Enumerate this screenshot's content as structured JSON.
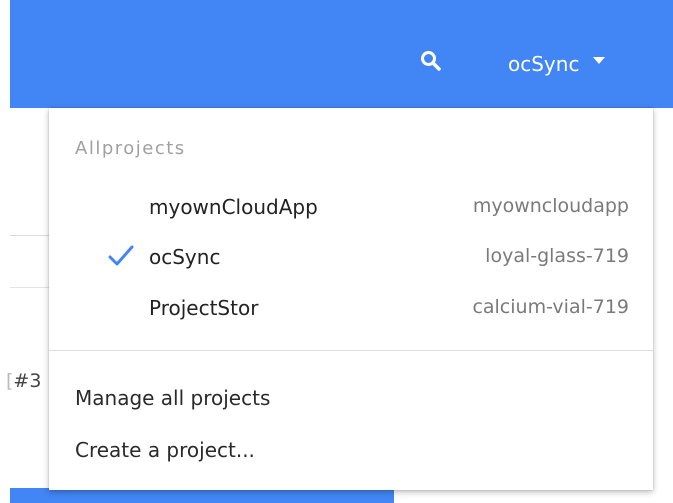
{
  "topbar": {
    "color": "#4285f4",
    "search_icon": "search-icon",
    "current_project": "ocSync",
    "caret_icon": "caret-down-icon"
  },
  "background": {
    "partial_text": "#3"
  },
  "menu": {
    "header": "Allprojects",
    "projects": [
      {
        "name": "myownCloudApp",
        "id": "myowncloudapp",
        "selected": false
      },
      {
        "name": "ocSync",
        "id": "loyal-glass-719",
        "selected": true
      },
      {
        "name": "ProjectStor",
        "id": "calcium-vial-719",
        "selected": false
      }
    ],
    "check_icon": "checkmark-icon",
    "check_color": "#4285f4",
    "actions": {
      "manage": "Manage all projects",
      "create": "Create a project..."
    }
  }
}
